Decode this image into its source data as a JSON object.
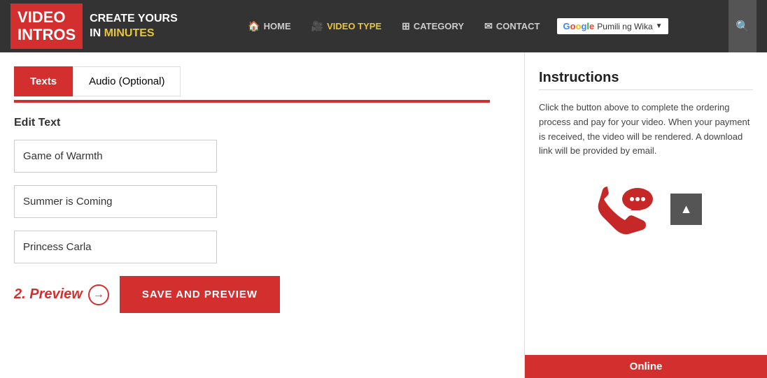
{
  "header": {
    "logo_video": "VIDEO\nINTROS",
    "logo_create": "CREATE YOURS\nIN ",
    "logo_minutes": "MINUTES",
    "nav": [
      {
        "label": "HOME",
        "icon": "🏠",
        "active": false
      },
      {
        "label": "VIDEO TYPE",
        "icon": "🎥",
        "active": true
      },
      {
        "label": "CATEGORY",
        "icon": "⊞",
        "active": false
      },
      {
        "label": "CONTACT",
        "icon": "✉",
        "active": false
      }
    ],
    "translate_label": "Pumili ng Wika",
    "translate_arrow": "▼"
  },
  "tabs": [
    {
      "label": "Texts",
      "active": true
    },
    {
      "label": "Audio (Optional)",
      "active": false
    }
  ],
  "edit_text": {
    "section_label": "Edit Text",
    "fields": [
      {
        "value": "Game of Warmth"
      },
      {
        "value": "Summer is Coming"
      },
      {
        "value": "Princess Carla"
      }
    ]
  },
  "preview": {
    "label": "2. Preview",
    "button_label": "SAVE AND PREVIEW"
  },
  "sidebar": {
    "instructions_title": "Instructions",
    "instructions_body": "Click the button above to complete the ordering process and pay for your video. When your payment is received, the video will be rendered. A download link will be provided by email.",
    "online_label": "Online"
  }
}
